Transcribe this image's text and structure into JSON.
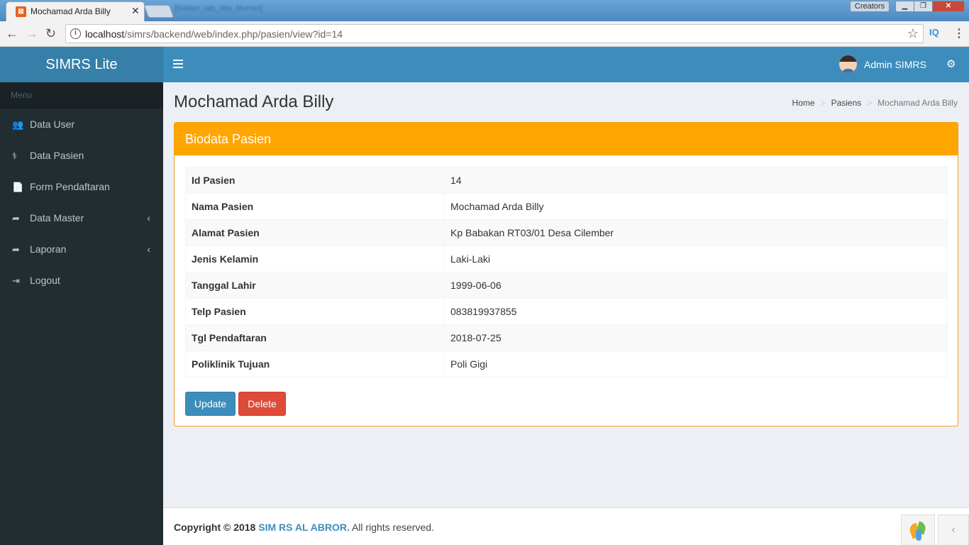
{
  "browser": {
    "tab_title": "Mochamad Arda Billy",
    "tab_close": "✕",
    "background_tab_title": "[hidden_tab_title_blurred]",
    "creators_label": "Creators",
    "url_host": "localhost",
    "url_path": "/simrs/backend/web/index.php/pasien/view?id=14",
    "extension_label": "IQ"
  },
  "app": {
    "logo": "SIMRS Lite",
    "user_name": "Admin SIMRS"
  },
  "sidebar": {
    "header": "Menu",
    "items": [
      {
        "label": "Data User",
        "icon": "👥",
        "has_chevron": false
      },
      {
        "label": "Data Pasien",
        "icon": "⚕",
        "has_chevron": false
      },
      {
        "label": "Form Pendaftaran",
        "icon": "📄",
        "has_chevron": false
      },
      {
        "label": "Data Master",
        "icon": "➦",
        "has_chevron": true
      },
      {
        "label": "Laporan",
        "icon": "➦",
        "has_chevron": true
      },
      {
        "label": "Logout",
        "icon": "⇥",
        "has_chevron": false
      }
    ],
    "chevron": "‹"
  },
  "page": {
    "title": "Mochamad Arda Billy",
    "breadcrumb": {
      "home": "Home",
      "section": "Pasiens",
      "current": "Mochamad Arda Billy",
      "separator": ">"
    }
  },
  "box": {
    "header": "Biodata Pasien",
    "rows": [
      {
        "label": "Id Pasien",
        "value": "14"
      },
      {
        "label": "Nama Pasien",
        "value": "Mochamad Arda Billy"
      },
      {
        "label": "Alamat Pasien",
        "value": "Kp Babakan RT03/01 Desa Cilember"
      },
      {
        "label": "Jenis Kelamin",
        "value": "Laki-Laki"
      },
      {
        "label": "Tanggal Lahir",
        "value": "1999-06-06"
      },
      {
        "label": "Telp Pasien",
        "value": "083819937855"
      },
      {
        "label": "Tgl Pendaftaran",
        "value": "2018-07-25"
      },
      {
        "label": "Poliklinik Tujuan",
        "value": "Poli Gigi"
      }
    ],
    "update_label": "Update",
    "delete_label": "Delete"
  },
  "footer": {
    "copyright": "Copyright © 2018",
    "org": "SIM RS AL ABROR.",
    "rights": "All rights reserved."
  },
  "colors": {
    "header_blue": "#3c8dbc",
    "logo_blue": "#367fa9",
    "sidebar_dark": "#222d32",
    "box_orange": "#ffa500",
    "btn_primary": "#3c8dbc",
    "btn_danger": "#dd4b39"
  }
}
